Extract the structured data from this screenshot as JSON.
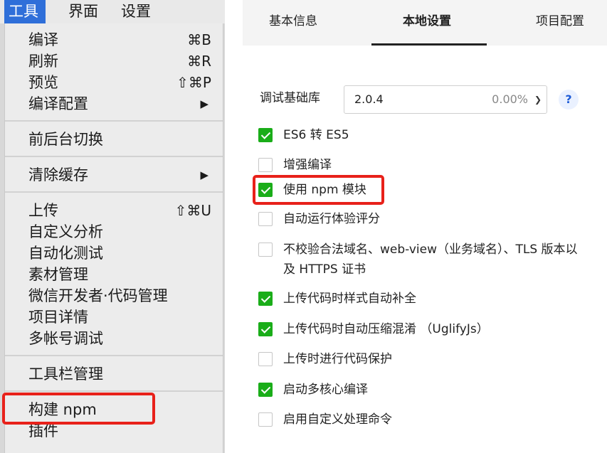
{
  "menubar": {
    "items": [
      "工具",
      "界面",
      "设置"
    ]
  },
  "menu": {
    "items": [
      {
        "label": "编译",
        "shortcut": "⌘B"
      },
      {
        "label": "刷新",
        "shortcut": "⌘R"
      },
      {
        "label": "预览",
        "shortcut": "⇧⌘P"
      },
      {
        "label": "编译配置",
        "arrow": "▶"
      },
      {
        "label": "前后台切换"
      },
      {
        "label": "清除缓存",
        "arrow": "▶"
      },
      {
        "label": "上传",
        "shortcut": "⇧⌘U"
      },
      {
        "label": "自定义分析"
      },
      {
        "label": "自动化测试"
      },
      {
        "label": "素材管理"
      },
      {
        "label": "微信开发者·代码管理"
      },
      {
        "label": "项目详情"
      },
      {
        "label": "多帐号调试"
      },
      {
        "label": "工具栏管理"
      },
      {
        "label": "构建 npm"
      },
      {
        "label": "插件"
      }
    ]
  },
  "settings": {
    "tabs": [
      "基本信息",
      "本地设置",
      "项目配置"
    ],
    "active_tab": "本地设置",
    "base_lib": {
      "label": "调试基础库",
      "value": "2.0.4",
      "percent": "0.00%",
      "help": "?"
    },
    "options": [
      {
        "label": "ES6 转 ES5",
        "checked": true
      },
      {
        "label": "增强编译",
        "checked": false
      },
      {
        "label": "使用 npm 模块",
        "checked": true
      },
      {
        "label": "自动运行体验评分",
        "checked": false
      },
      {
        "label": "不校验合法域名、web-view（业务域名）、TLS 版本以及 HTTPS 证书",
        "checked": false
      },
      {
        "label": "上传代码时样式自动补全",
        "checked": true
      },
      {
        "label": "上传代码时自动压缩混淆 （UglifyJs）",
        "checked": true
      },
      {
        "label": "上传时进行代码保护",
        "checked": false
      },
      {
        "label": "启动多核心编译",
        "checked": true
      },
      {
        "label": "启用自定义处理命令",
        "checked": false
      }
    ]
  },
  "colors": {
    "menu_active": "#2f6fd9",
    "checkbox_on": "#1aad19",
    "highlight": "#e8211a",
    "help_accent": "#1f5cd6"
  }
}
